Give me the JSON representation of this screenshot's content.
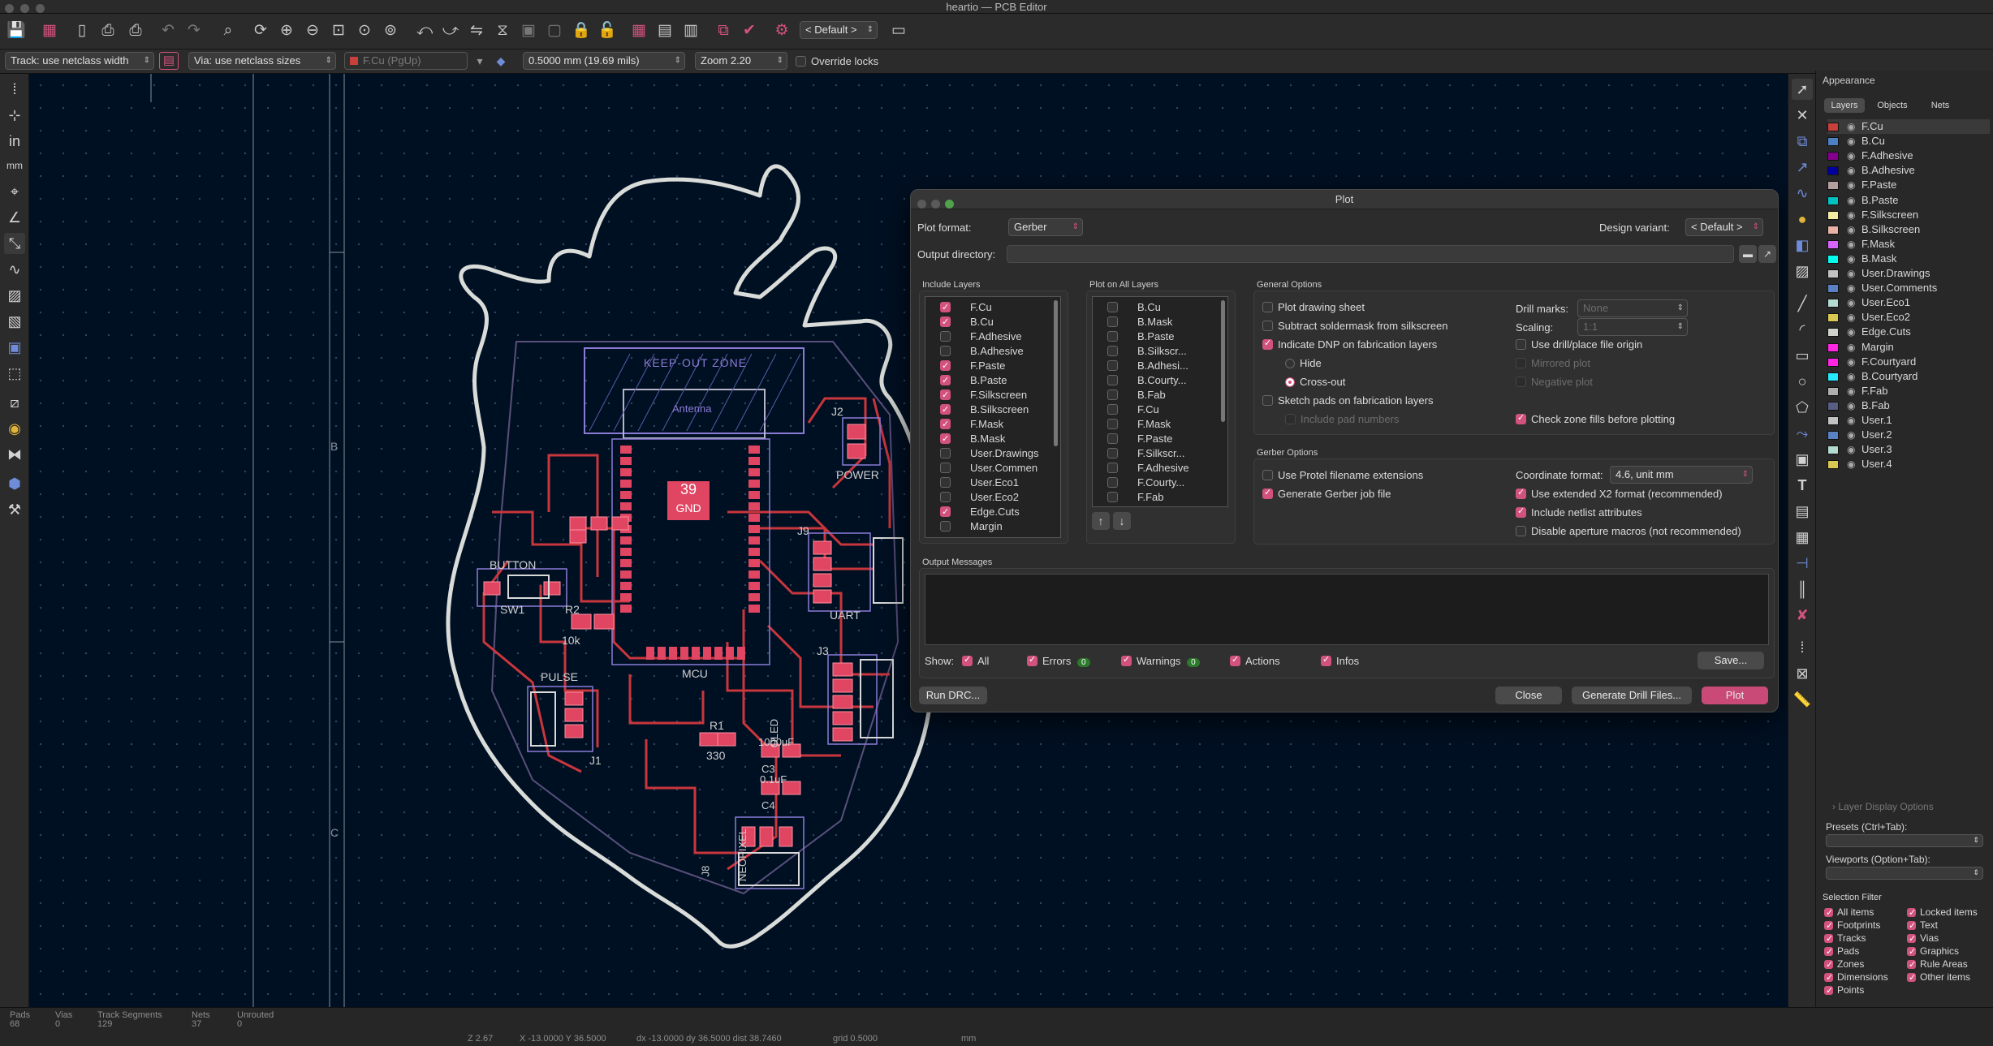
{
  "window": {
    "title": "heartio — PCB Editor"
  },
  "toolbar": {
    "variant": "< Default >"
  },
  "toolbar2": {
    "track": "Track: use netclass width",
    "via": "Via: use netclass sizes",
    "layer": "F.Cu (PgUp)",
    "grid": "0.5000 mm (19.69 mils)",
    "zoom": "Zoom 2.20",
    "override_locks": "Override locks"
  },
  "canvas": {
    "sheet_b": "B",
    "sheet_c": "C",
    "keepout": "KEEP-OUT ZONE",
    "antenna": "Antenna",
    "gnd_num": "39",
    "gnd": "GND",
    "button": "BUTTON",
    "sw1": "SW1",
    "r2": "R2",
    "r2v": "10k",
    "pulse": "PULSE",
    "j1": "J1",
    "j2": "J2",
    "power": "POWER",
    "j9": "J9",
    "uart": "UART",
    "j3": "J3",
    "mcu": "MCU",
    "r1": "R1",
    "r1v": "330",
    "oled": "OLED",
    "c1000": "1000uF",
    "c3": "C3",
    "c01": "0.1uF",
    "c4": "C4",
    "neopixel": "NEOPIXEL",
    "j8": "J8"
  },
  "dialog": {
    "title": "Plot",
    "plot_format_label": "Plot format:",
    "plot_format": "Gerber",
    "design_variant_label": "Design variant:",
    "design_variant": "< Default >",
    "output_dir_label": "Output directory:",
    "include_layers_label": "Include Layers",
    "include_layers": [
      {
        "name": "F.Cu",
        "checked": true
      },
      {
        "name": "B.Cu",
        "checked": true
      },
      {
        "name": "F.Adhesive",
        "checked": false
      },
      {
        "name": "B.Adhesive",
        "checked": false
      },
      {
        "name": "F.Paste",
        "checked": true
      },
      {
        "name": "B.Paste",
        "checked": true
      },
      {
        "name": "F.Silkscreen",
        "checked": true
      },
      {
        "name": "B.Silkscreen",
        "checked": true
      },
      {
        "name": "F.Mask",
        "checked": true
      },
      {
        "name": "B.Mask",
        "checked": true
      },
      {
        "name": "User.Drawings",
        "checked": false
      },
      {
        "name": "User.Commen",
        "checked": false
      },
      {
        "name": "User.Eco1",
        "checked": false
      },
      {
        "name": "User.Eco2",
        "checked": false
      },
      {
        "name": "Edge.Cuts",
        "checked": true
      },
      {
        "name": "Margin",
        "checked": false
      }
    ],
    "plot_all_label": "Plot on All Layers",
    "plot_all_layers": [
      "B.Cu",
      "B.Mask",
      "B.Paste",
      "B.Silkscr...",
      "B.Adhesi...",
      "B.Courty...",
      "B.Fab",
      "F.Cu",
      "F.Mask",
      "F.Paste",
      "F.Silkscr...",
      "F.Adhesive",
      "F.Courty...",
      "F.Fab"
    ],
    "general_options_label": "General Options",
    "opt_plot_sheet": "Plot drawing sheet",
    "opt_subtract": "Subtract soldermask from silkscreen",
    "opt_dnp": "Indicate DNP on fabrication layers",
    "opt_hide": "Hide",
    "opt_crossout": "Cross-out",
    "opt_sketch": "Sketch pads on fabrication layers",
    "opt_padnum": "Include pad numbers",
    "drill_marks_label": "Drill marks:",
    "drill_marks": "None",
    "scaling_label": "Scaling:",
    "scaling": "1:1",
    "opt_drill_origin": "Use drill/place file origin",
    "opt_mirrored": "Mirrored plot",
    "opt_negative": "Negative plot",
    "opt_zone_fills": "Check zone fills before plotting",
    "gerber_options_label": "Gerber Options",
    "opt_protel": "Use Protel filename extensions",
    "opt_jobfile": "Generate Gerber job file",
    "coord_format_label": "Coordinate format:",
    "coord_format": "4.6, unit mm",
    "opt_x2": "Use extended X2 format (recommended)",
    "opt_netlist": "Include netlist attributes",
    "opt_aperture": "Disable aperture macros (not recommended)",
    "output_messages_label": "Output Messages",
    "show_label": "Show:",
    "show_all": "All",
    "show_errors": "Errors",
    "errors_count": "0",
    "show_warnings": "Warnings",
    "warnings_count": "0",
    "show_actions": "Actions",
    "show_infos": "Infos",
    "save_btn": "Save...",
    "run_drc_btn": "Run DRC...",
    "close_btn": "Close",
    "drill_btn": "Generate Drill Files...",
    "plot_btn": "Plot"
  },
  "appearance": {
    "title": "Appearance",
    "tabs": [
      "Layers",
      "Objects",
      "Nets"
    ],
    "layers": [
      {
        "name": "F.Cu",
        "color": "#c8403c"
      },
      {
        "name": "B.Cu",
        "color": "#4d7fc4"
      },
      {
        "name": "F.Adhesive",
        "color": "#84008c"
      },
      {
        "name": "B.Adhesive",
        "color": "#0000a0"
      },
      {
        "name": "F.Paste",
        "color": "#b49e9e"
      },
      {
        "name": "B.Paste",
        "color": "#00c2c2"
      },
      {
        "name": "F.Silkscreen",
        "color": "#f2eda1"
      },
      {
        "name": "B.Silkscreen",
        "color": "#e8b2a7"
      },
      {
        "name": "F.Mask",
        "color": "#d864ff"
      },
      {
        "name": "B.Mask",
        "color": "#02ffee"
      },
      {
        "name": "User.Drawings",
        "color": "#c2c2c2"
      },
      {
        "name": "User.Comments",
        "color": "#5981c4"
      },
      {
        "name": "User.Eco1",
        "color": "#b4dbd2"
      },
      {
        "name": "User.Eco2",
        "color": "#d8c852"
      },
      {
        "name": "Edge.Cuts",
        "color": "#d0d2cd"
      },
      {
        "name": "Margin",
        "color": "#ff26e2"
      },
      {
        "name": "F.Courtyard",
        "color": "#ff26e2"
      },
      {
        "name": "B.Courtyard",
        "color": "#26e9ff"
      },
      {
        "name": "F.Fab",
        "color": "#afafaf"
      },
      {
        "name": "B.Fab",
        "color": "#585d84"
      },
      {
        "name": "User.1",
        "color": "#c2c2c2"
      },
      {
        "name": "User.2",
        "color": "#5981c4"
      },
      {
        "name": "User.3",
        "color": "#b4dbd2"
      },
      {
        "name": "User.4",
        "color": "#d8c852"
      }
    ],
    "layer_display_options": "Layer Display Options",
    "presets_label": "Presets (Ctrl+Tab):",
    "viewports_label": "Viewports (Option+Tab):",
    "selection_filter_label": "Selection Filter",
    "filters_left": [
      "All items",
      "Footprints",
      "Tracks",
      "Pads",
      "Zones",
      "Dimensions",
      "Points"
    ],
    "filters_right": [
      "Locked items",
      "Text",
      "Vias",
      "Graphics",
      "Rule Areas",
      "Other items"
    ]
  },
  "status": {
    "pads_label": "Pads",
    "pads": "68",
    "vias_label": "Vias",
    "vias": "0",
    "tracks_label": "Track Segments",
    "tracks": "129",
    "nets_label": "Nets",
    "nets": "37",
    "unrouted_label": "Unrouted",
    "unrouted": "0",
    "z": "Z 2.67",
    "xy": "X -13.0000  Y 36.5000",
    "dxy": "dx -13.0000  dy 36.5000  dist 38.7460",
    "grid": "grid 0.5000",
    "units": "mm"
  }
}
